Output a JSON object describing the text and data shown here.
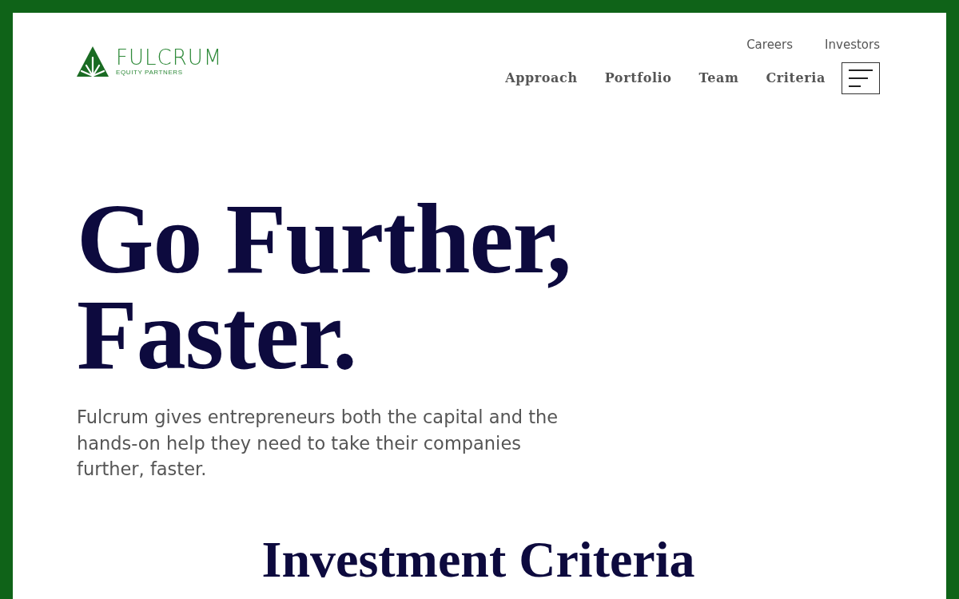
{
  "header": {
    "logo": {
      "name": "FULCRUM",
      "tagline": "EQUITY PARTNERS"
    },
    "utility_nav": [
      {
        "label": "Careers"
      },
      {
        "label": "Investors"
      }
    ],
    "main_nav": [
      {
        "label": "Approach"
      },
      {
        "label": "Portfolio"
      },
      {
        "label": "Team"
      },
      {
        "label": "Criteria"
      }
    ]
  },
  "hero": {
    "headline_lines": [
      "Go Further,",
      "Faster."
    ],
    "description": "Fulcrum gives entrepreneurs both the capital and the hands-on help they need to take their companies further, faster."
  },
  "next_section": {
    "heading": "Investment Criteria"
  }
}
